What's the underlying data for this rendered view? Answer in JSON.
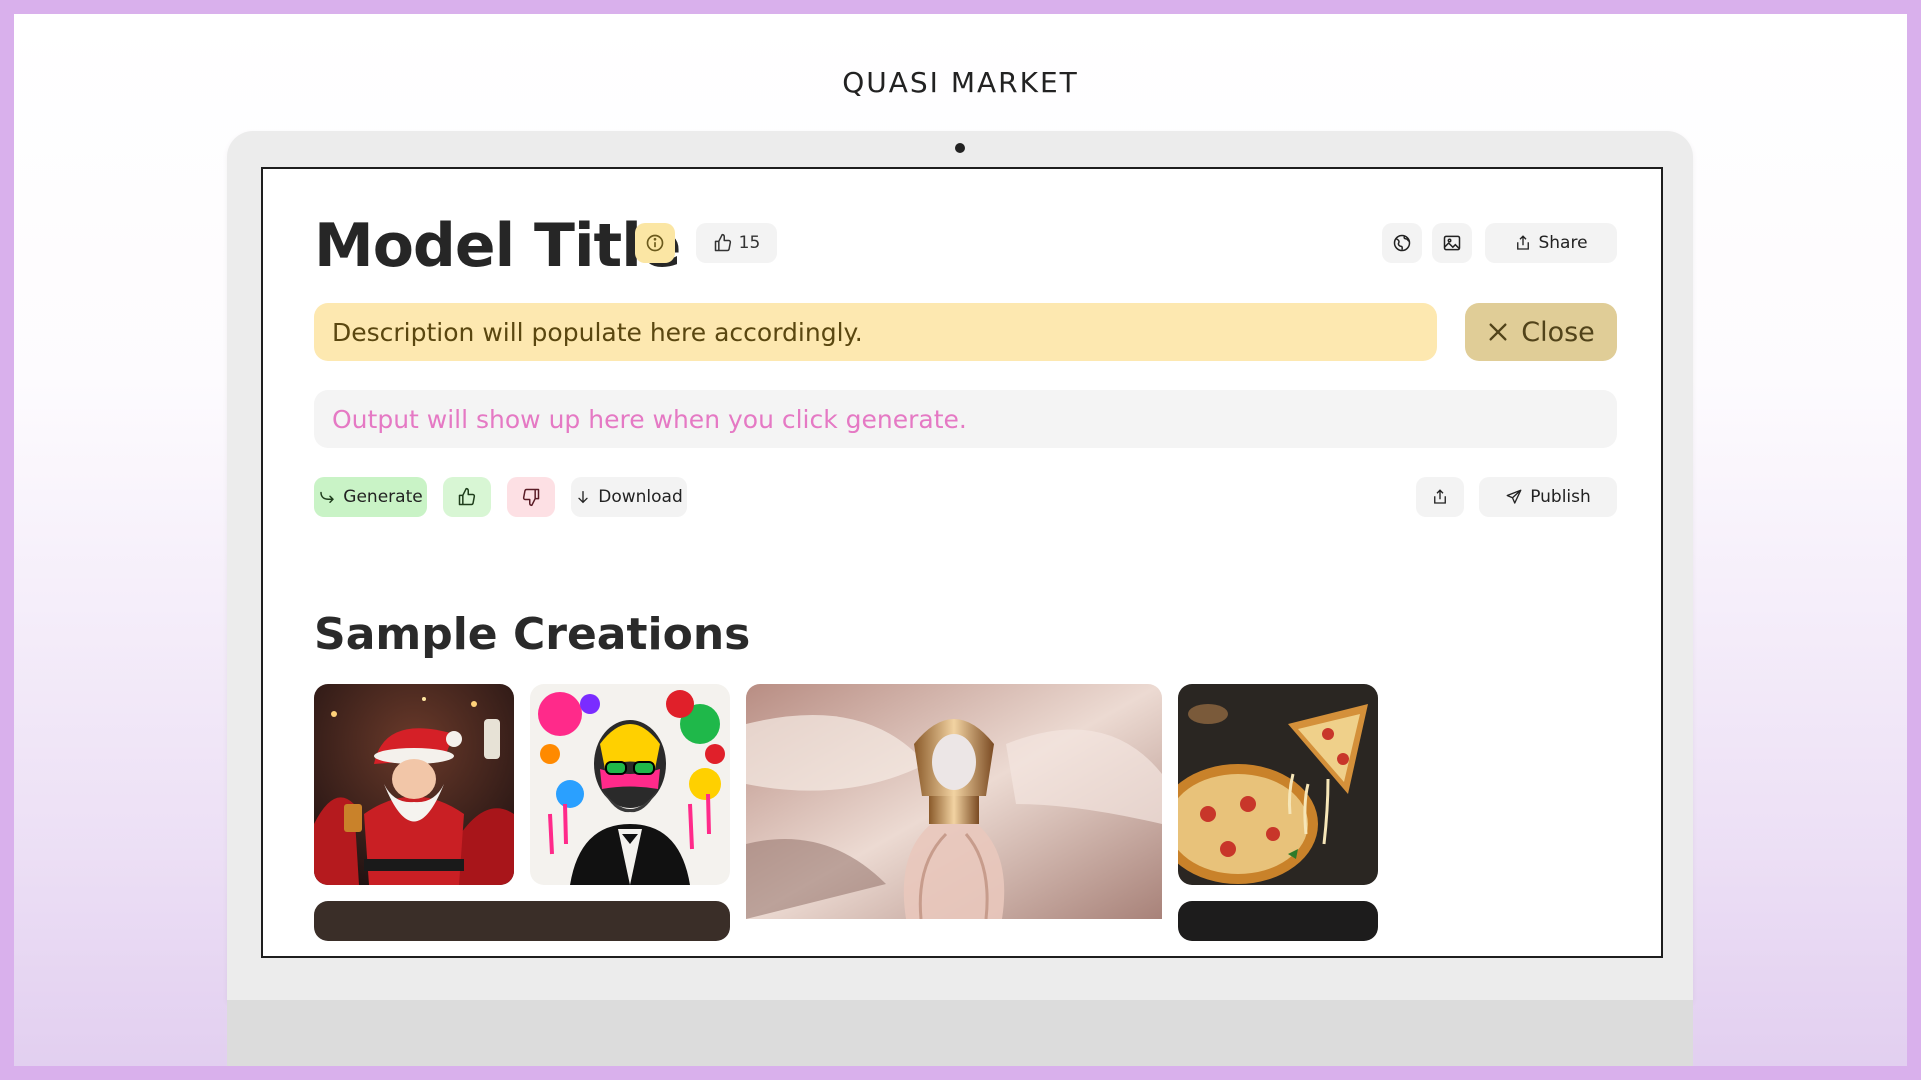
{
  "brand": "QUASI MARKET",
  "model": {
    "title": "Model Title",
    "likes": "15"
  },
  "header_actions": {
    "share_label": "Share"
  },
  "description": {
    "text": "Description will populate here accordingly.",
    "close_label": "Close"
  },
  "output": {
    "placeholder": "Output will show up here when you click generate."
  },
  "toolbar": {
    "generate_label": "Generate",
    "download_label": "Download",
    "publish_label": "Publish"
  },
  "gallery": {
    "title": "Sample Creations",
    "items": [
      {
        "subject": "santa-party"
      },
      {
        "subject": "pop-art-portrait"
      },
      {
        "subject": "perfume-bottle"
      },
      {
        "subject": "pizza"
      }
    ]
  },
  "colors": {
    "border_purple": "#d9b0ec",
    "description_bg": "#fde8b0",
    "close_bg": "#e0cd97",
    "output_text": "#e579c4",
    "generate_bg": "#c9f3c6",
    "like_bg": "#d8f6d4",
    "dislike_bg": "#fde0e4"
  }
}
